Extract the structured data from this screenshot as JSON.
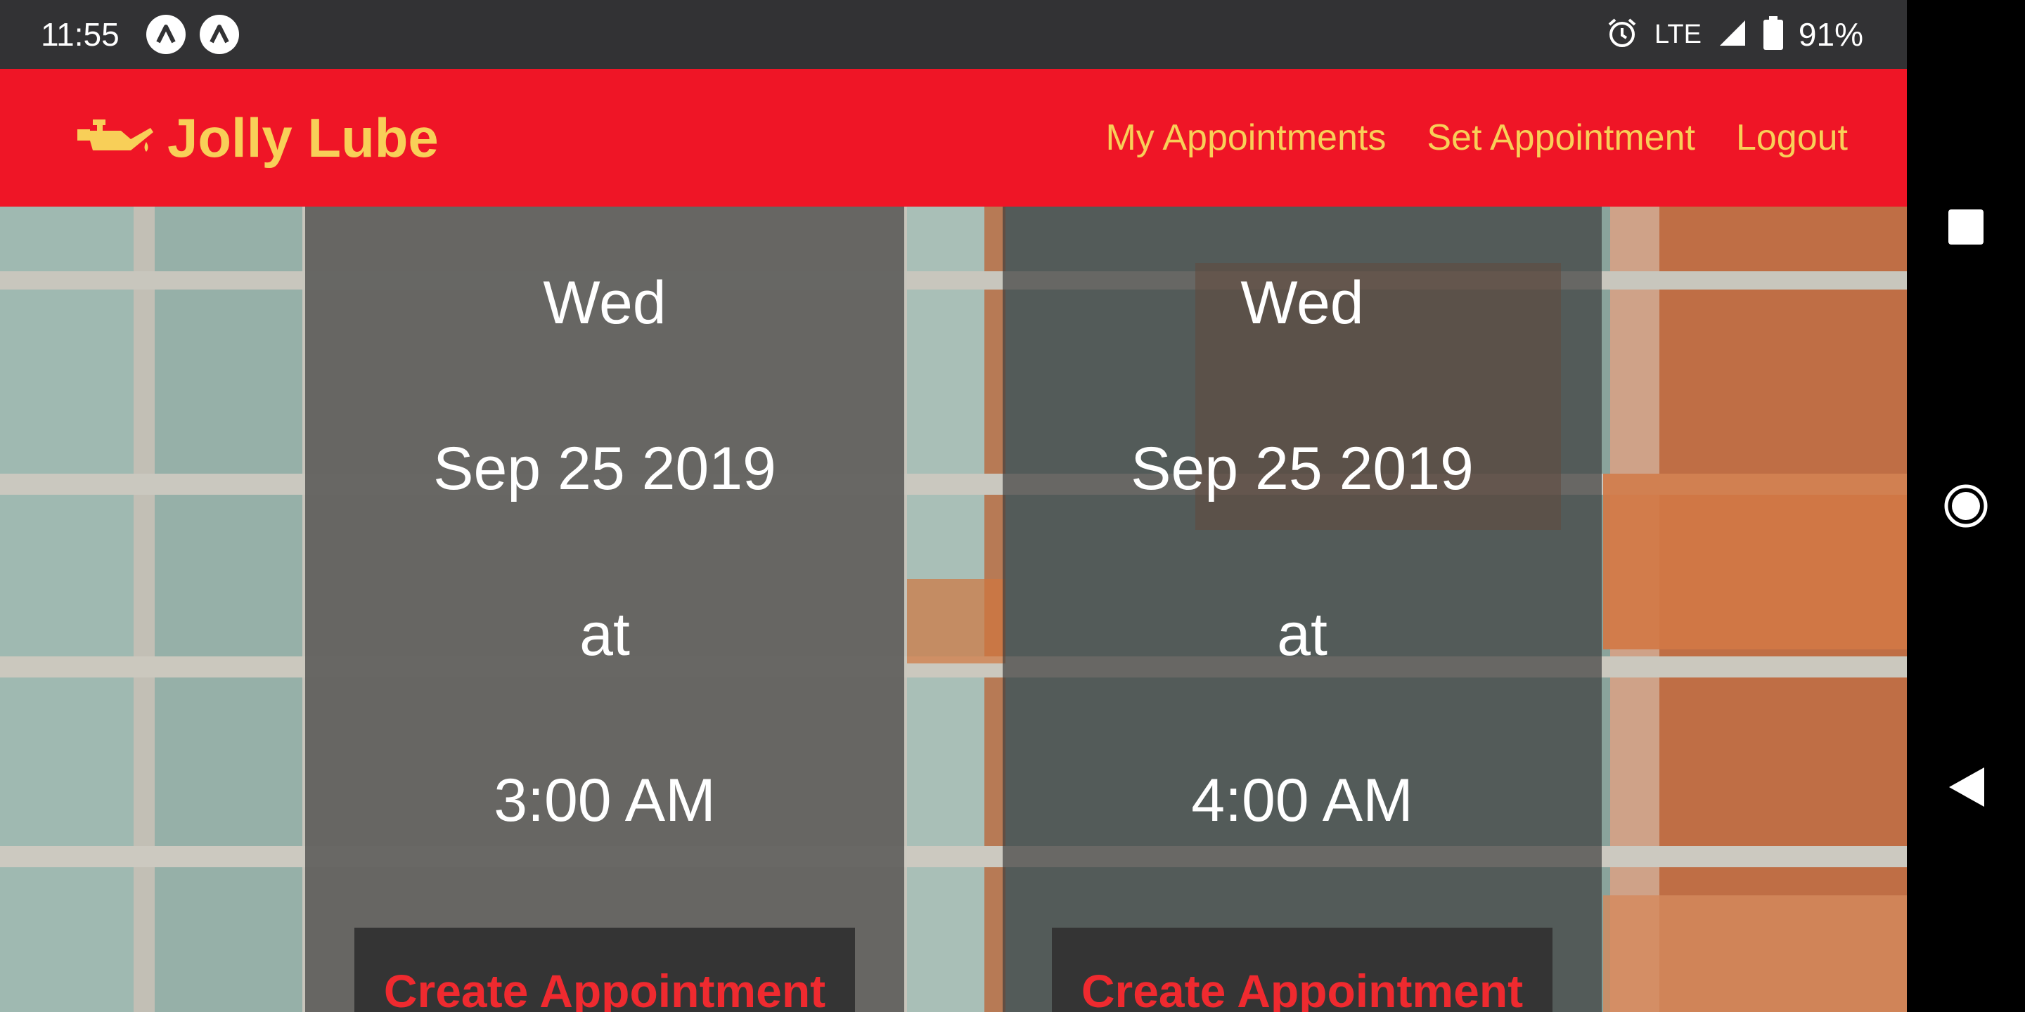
{
  "status_bar": {
    "time": "11:55",
    "network": "LTE",
    "battery": "91%",
    "notification_icons": [
      "app-notification-icon",
      "app-notification-icon"
    ]
  },
  "navbar": {
    "brand": "Jolly Lube",
    "brand_icon": "oil-can-icon",
    "links": [
      "My Appointments",
      "Set Appointment",
      "Logout"
    ]
  },
  "appointments": [
    {
      "day": "Wed",
      "date": "Sep 25 2019",
      "at": "at",
      "time": "3:00 AM",
      "button": "Create Appointment"
    },
    {
      "day": "Wed",
      "date": "Sep 25 2019",
      "at": "at",
      "time": "4:00 AM",
      "button": "Create Appointment"
    }
  ],
  "system_nav": [
    "overview-icon",
    "home-icon",
    "back-icon"
  ],
  "colors": {
    "navbar_bg": "#ef1526",
    "brand_text": "#f8cf58",
    "statusbar_bg": "#323234",
    "card_bg": "rgba(58,58,58,0.68)",
    "button_text": "#ef2a2f"
  }
}
